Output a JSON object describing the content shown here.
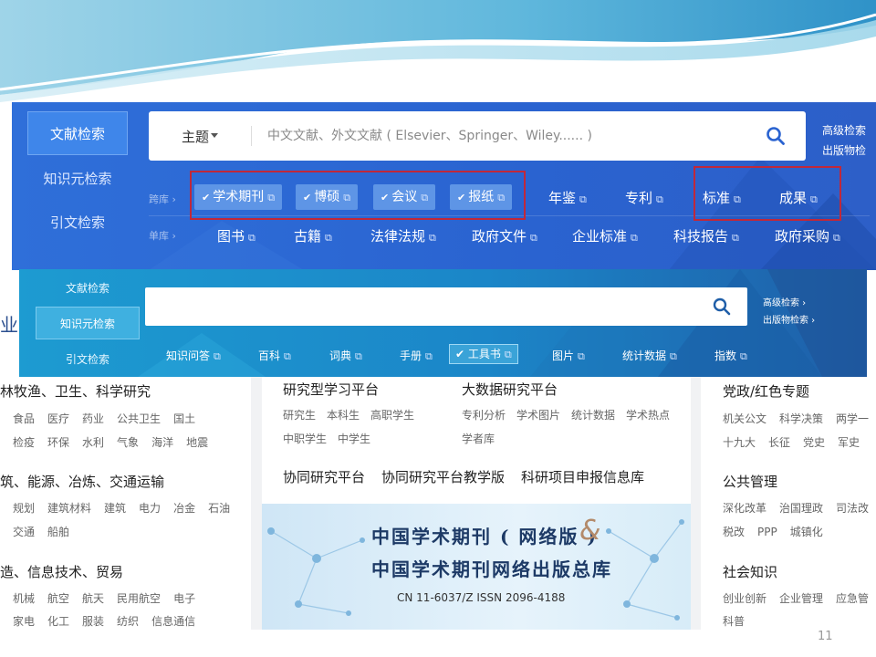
{
  "top_panel": {
    "side_tabs": [
      "文献检索",
      "知识元检索",
      "引文检索"
    ],
    "subject_label": "主题",
    "search_placeholder": "中文文献、外文文献 ( Elsevier、Springer、Wiley...... )",
    "adv_search": "高级检索",
    "pub_search": "出版物检",
    "row1_label": "跨库 ›",
    "row2_label": "单库 ›",
    "checked_tags": [
      "学术期刊",
      "博硕",
      "会议",
      "报纸"
    ],
    "plain_tags": [
      "年鉴",
      "专利",
      "标准",
      "成果"
    ],
    "row2_tags": [
      "图书",
      "古籍",
      "法律法规",
      "政府文件",
      "企业标准",
      "科技报告",
      "政府采购"
    ]
  },
  "second_panel": {
    "side_tabs": [
      "文献检索",
      "知识元检索",
      "引文检索"
    ],
    "adv_search": "高级检索 ›",
    "pub_search": "出版物检索 ›",
    "tags": [
      "知识问答",
      "百科",
      "词典",
      "手册",
      "工具书",
      "图片",
      "统计数据",
      "指数"
    ],
    "active_tag": "工具书"
  },
  "home_page": {
    "left_fragment": "业",
    "left_categories": [
      {
        "title": "林牧渔、卫生、科学研究",
        "items": [
          "食品",
          "医疗",
          "药业",
          "公共卫生",
          "国土"
        ],
        "items2": [
          "检疫",
          "环保",
          "水利",
          "气象",
          "海洋",
          "地震"
        ]
      },
      {
        "title": "筑、能源、冶炼、交通运输",
        "items": [
          "规划",
          "建筑材料",
          "建筑",
          "电力",
          "冶金",
          "石油"
        ],
        "items2": [
          "交通",
          "船舶"
        ]
      },
      {
        "title": "造、信息技术、贸易",
        "items": [
          "机械",
          "航空",
          "航天",
          "民用航空",
          "电子"
        ],
        "items2": [
          "家电",
          "化工",
          "服装",
          "纺织",
          "信息通信"
        ]
      }
    ],
    "platforms": {
      "p1_title": "研究型学习平台",
      "p1_items": [
        "研究生",
        "本科生",
        "高职学生"
      ],
      "p1_items2": [
        "中职学生",
        "中学生"
      ],
      "p2_title": "大数据研究平台",
      "p2_items": [
        "专利分析",
        "学术图片",
        "统计数据",
        "学术热点"
      ],
      "p2_items2": [
        "学者库"
      ],
      "row3": [
        "协同研究平台",
        "协同研究平台教学版",
        "科研项目申报信息库"
      ]
    },
    "ad": {
      "line1": "中国学术期刊 ( 网络版 )",
      "amp": "&",
      "line2": "中国学术期刊网络出版总库",
      "issn": "CN 11-6037/Z    ISSN 2096-4188"
    },
    "right_categories": [
      {
        "title": "党政/红色专题",
        "items": [
          "机关公文",
          "科学决策",
          "两学一"
        ],
        "items2": [
          "十九大",
          "长征",
          "党史",
          "军史"
        ]
      },
      {
        "title": "公共管理",
        "items": [
          "深化改革",
          "治国理政",
          "司法改"
        ],
        "items2": [
          "税改",
          "PPP",
          "城镇化"
        ]
      },
      {
        "title": "社会知识",
        "items": [
          "创业创新",
          "企业管理",
          "应急管"
        ],
        "items2": [
          "科普"
        ]
      }
    ]
  },
  "page_number": "11",
  "colors": {
    "top_panel": "#2a63d0",
    "second_panel": "#1b86c8",
    "highlight_box": "#c0283a"
  }
}
